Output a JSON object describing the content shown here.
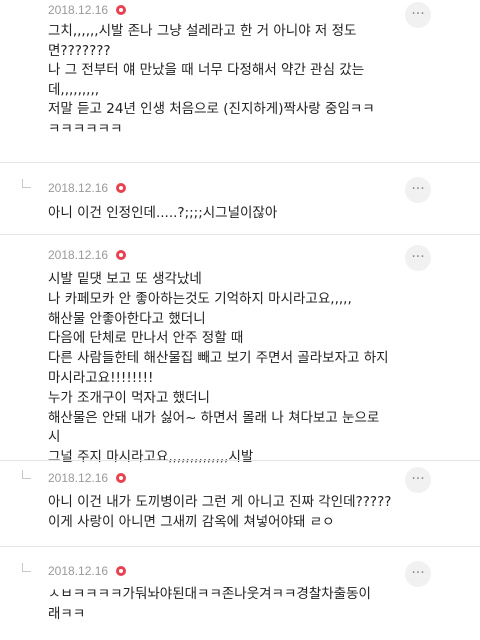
{
  "comments": [
    {
      "date": "2018.12.16",
      "is_reply": false,
      "more_icon": "more-options-icon",
      "text": "그치,,,,,,시발 존나 그냥 설레라고 한 거 아니야 저 정도\n면???????\n나 그 전부터 얘 만났을 때 너무 다정해서 약간 관심 갔는\n데,,,,,,,,,\n저말 듣고 24년 인생 처음으로 (진지하게)짝사랑 중임ㅋㅋ\nㅋㅋㅋㅋㅋㅋ"
    },
    {
      "date": "2018.12.16",
      "is_reply": true,
      "more_icon": "more-options-icon",
      "text": "아니 이건 인정인데.....?;;;;시그널이잖아"
    },
    {
      "date": "2018.12.16",
      "is_reply": false,
      "more_icon": "more-options-icon",
      "text": "시발 밑댓 보고 또 생각났네\n나 카페모카 안 좋아하는것도 기억하지 마시라고요,,,,,\n해산물 안좋아한다고 했더니\n다음에 단체로 만나서 안주 정할 때\n다른 사람들한테 해산물집 빼고 보기 주면서 골라보자고 하지\n마시라고요!!!!!!!!\n누가 조개구이 먹자고 했더니\n해산물은 안돼 내가 싫어~ 하면서 몰래 나 쳐다보고 눈으로 시\n그널 주지 마시라고요,,,,,,,,,,,,,,시발"
    },
    {
      "date": "2018.12.16",
      "is_reply": true,
      "more_icon": "more-options-icon",
      "text": "아니 이건 내가 도끼병이라 그런 게 아니고 진짜 각인데?????\n이게 사랑이 아니면 그새끼 감옥에 쳐넣어야돼 ㄹㅇ"
    },
    {
      "date": "2018.12.16",
      "is_reply": true,
      "more_icon": "more-options-icon",
      "text": "ㅅㅂㅋㅋㅋㅋ가둬놔야된대ㅋㅋ존나웃겨ㅋㅋ경찰차출동이\n래ㅋㅋ"
    }
  ],
  "colors": {
    "badge": "#e8414f",
    "date": "#9a9a9a",
    "separator": "#e4e4e4"
  }
}
